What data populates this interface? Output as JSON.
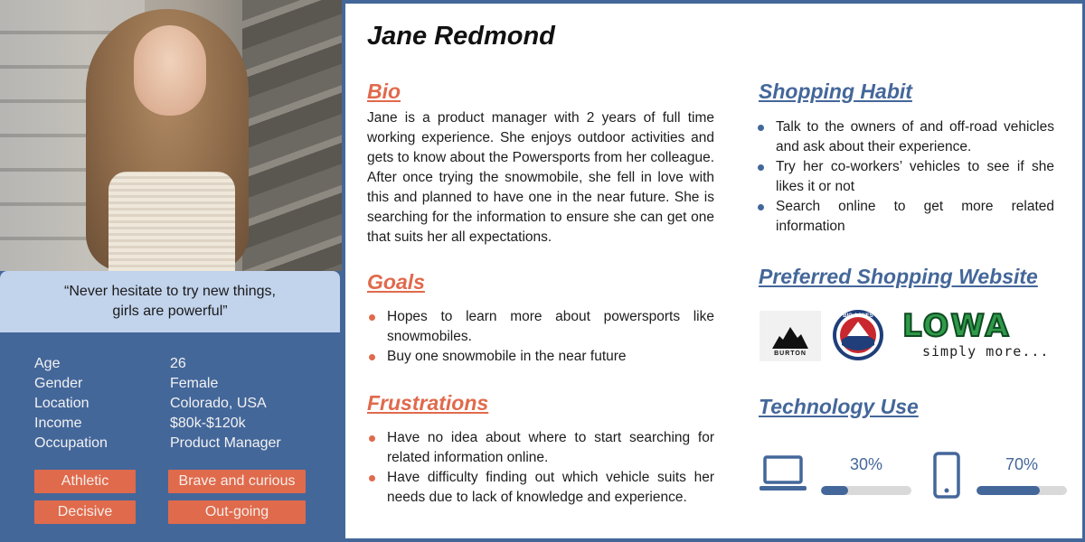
{
  "persona": {
    "name": "Jane Redmond",
    "quote": "“Never hesitate to try new things,\ngirls are powerful”",
    "info": [
      {
        "label": "Age",
        "value": "26"
      },
      {
        "label": "Gender",
        "value": "Female"
      },
      {
        "label": "Location",
        "value": "Colorado, USA"
      },
      {
        "label": "Income",
        "value": "$80k-$120k"
      },
      {
        "label": "Occupation",
        "value": "Product Manager"
      }
    ],
    "traits": [
      "Athletic",
      "Brave and curious",
      "Decisive",
      "Out-going"
    ]
  },
  "bio": {
    "heading": "Bio",
    "text": "Jane is a product manager with 2 years of full time working experience. She enjoys outdoor activities and gets to know about the Powersports from her colleague. After once trying the snowmobile, she fell in love with this and planned to have one in the near future. She is searching for the information to ensure she can get one that suits her all expectations."
  },
  "goals": {
    "heading": "Goals",
    "items": [
      "Hopes to learn more about powersports like snowmobiles.",
      "Buy one snowmobile in the near future"
    ]
  },
  "frustrations": {
    "heading": "Frustrations",
    "items": [
      "Have no idea about where to start searching for related information online.",
      "Have difficulty finding out which vehicle suits her needs due to lack of knowledge and experience."
    ]
  },
  "shopping_habit": {
    "heading": "Shopping Habit",
    "items": [
      "Talk to the owners of and off-road vehicles and ask about their experience.",
      "Try her co-workers’ vehicles to see if she likes it or not",
      "Search online to get more related information"
    ]
  },
  "preferred_websites": {
    "heading": "Preferred Shopping Website",
    "logos": [
      {
        "name": "burton-logo",
        "text": "BURTON"
      },
      {
        "name": "big-agnes-logo",
        "text": "BIG AGNES"
      },
      {
        "name": "lowa-logo",
        "text": "LOWA",
        "tagline": "simply more..."
      }
    ]
  },
  "technology_use": {
    "heading": "Technology Use",
    "devices": [
      {
        "icon": "laptop-icon",
        "label": "30%",
        "percent": 30
      },
      {
        "icon": "smartphone-icon",
        "label": "70%",
        "percent": 70
      }
    ]
  },
  "colors": {
    "accent_blue": "#44679a",
    "accent_orange": "#e06a4c",
    "quote_bg": "#c2d3ec"
  }
}
